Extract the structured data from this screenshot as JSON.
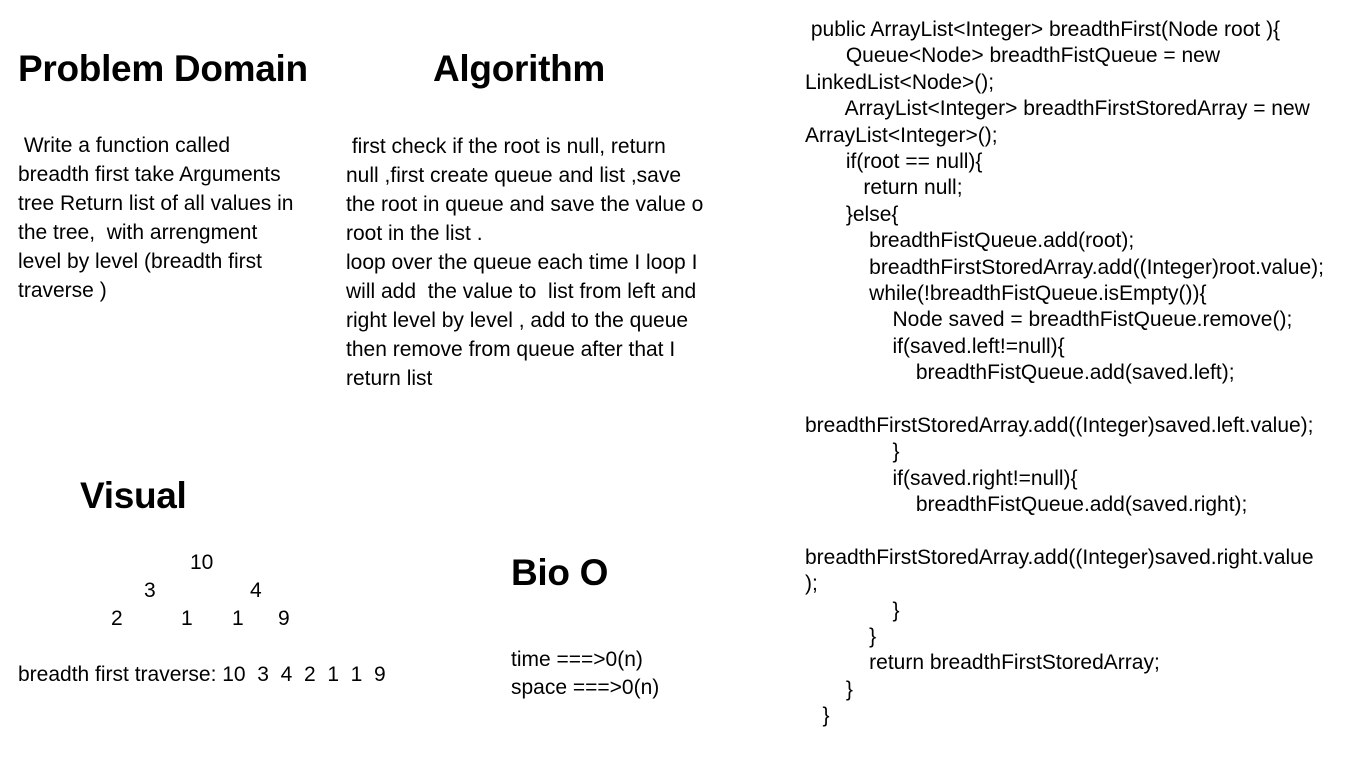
{
  "problem_domain": {
    "title": "Problem Domain",
    "lines": [
      " Write a function called",
      "breadth first take Arguments",
      "tree Return list of all values in",
      "the tree,  with arrengment",
      "level by level (breadth first",
      "traverse )"
    ]
  },
  "algorithm": {
    "title": "Algorithm",
    "lines": [
      " first check if the root is null, return",
      "null ,first create queue and list ,save",
      "the root in queue and save the value o",
      "root in the list .",
      "loop over the queue each time I loop I",
      "will add  the value to  list from left and",
      "right level by level , add to the queue",
      "then remove from queue after that I",
      "return list"
    ]
  },
  "visual": {
    "title": "Visual",
    "tree": {
      "root": "10",
      "level1": [
        "3",
        "4"
      ],
      "level2": [
        "2",
        "1",
        "1",
        "9"
      ]
    },
    "traverse_text": "breadth first traverse: 10  3  4  2  1  1  9"
  },
  "big_o": {
    "title": "Bio O",
    "lines": [
      "time ===>0(n)",
      "space ===>0(n)"
    ]
  },
  "code": {
    "lines": [
      " public ArrayList<Integer> breadthFirst(Node root ){",
      "       Queue<Node> breadthFistQueue = new",
      "LinkedList<Node>();",
      "       ArrayList<Integer> breadthFirstStoredArray = new",
      "ArrayList<Integer>();",
      "       if(root == null){",
      "          return null;",
      "       }else{",
      "           breadthFistQueue.add(root);",
      "           breadthFirstStoredArray.add((Integer)root.value);",
      "           while(!breadthFistQueue.isEmpty()){",
      "               Node saved = breadthFistQueue.remove();",
      "               if(saved.left!=null){",
      "                   breadthFistQueue.add(saved.left);",
      "",
      "breadthFirstStoredArray.add((Integer)saved.left.value);",
      "               }",
      "               if(saved.right!=null){",
      "                   breadthFistQueue.add(saved.right);",
      "",
      "breadthFirstStoredArray.add((Integer)saved.right.value",
      ");",
      "               }",
      "           }",
      "           return breadthFirstStoredArray;",
      "       }",
      "   }"
    ]
  }
}
